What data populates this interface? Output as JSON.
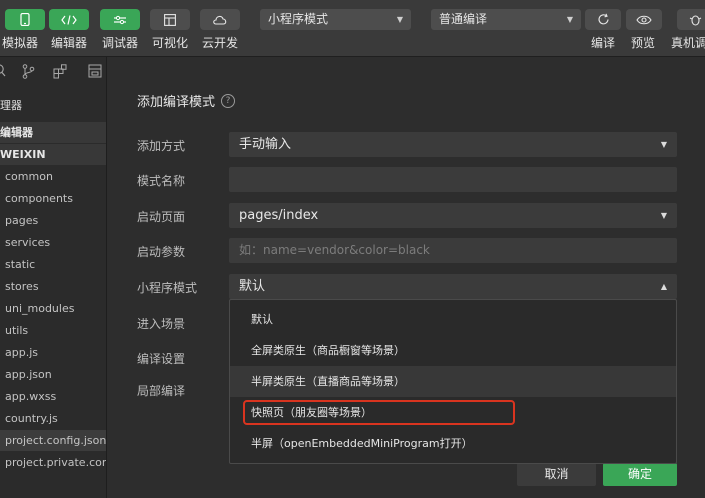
{
  "toolbar": {
    "buttons": [
      {
        "label": "模拟器",
        "icon": "phone-icon"
      },
      {
        "label": "编辑器",
        "icon": "code-icon"
      },
      {
        "label": "调试器",
        "icon": "debug-icon"
      },
      {
        "label": "可视化",
        "icon": "layout-icon"
      },
      {
        "label": "云开发",
        "icon": "cloud-icon"
      }
    ],
    "mode_select": "小程序模式",
    "compile_select": "普通编译",
    "compile_label": "编译",
    "preview_label": "预览",
    "realdevice_label": "真机调"
  },
  "sidebar": {
    "header": "理器",
    "open_editors": "编辑器",
    "project": "WEIXIN",
    "files": [
      "common",
      "components",
      "pages",
      "services",
      "static",
      "stores",
      "uni_modules",
      "utils",
      "app.js",
      "app.json",
      "app.wxss",
      "country.js",
      "project.config.json",
      "project.private.conf"
    ]
  },
  "dialog": {
    "title": "添加编译模式",
    "help": "?",
    "labels": {
      "add_method": "添加方式",
      "mode_name": "模式名称",
      "start_page": "启动页面",
      "start_params": "启动参数",
      "mp_mode": "小程序模式",
      "enter_scene": "进入场景",
      "compile_settings": "编译设置",
      "partial_compile": "局部编译"
    },
    "values": {
      "add_method": "手动输入",
      "mode_name": "",
      "start_page": "pages/index",
      "start_params_placeholder": "如：name=vendor&color=black",
      "mp_mode": "默认"
    },
    "dropdown_options": [
      "默认",
      "全屏类原生（商品橱窗等场景）",
      "半屏类原生（直播商品等场景）",
      "快照页（朋友圈等场景）",
      "半屏（openEmbeddedMiniProgram打开）"
    ],
    "cancel": "取消",
    "confirm": "确定"
  }
}
